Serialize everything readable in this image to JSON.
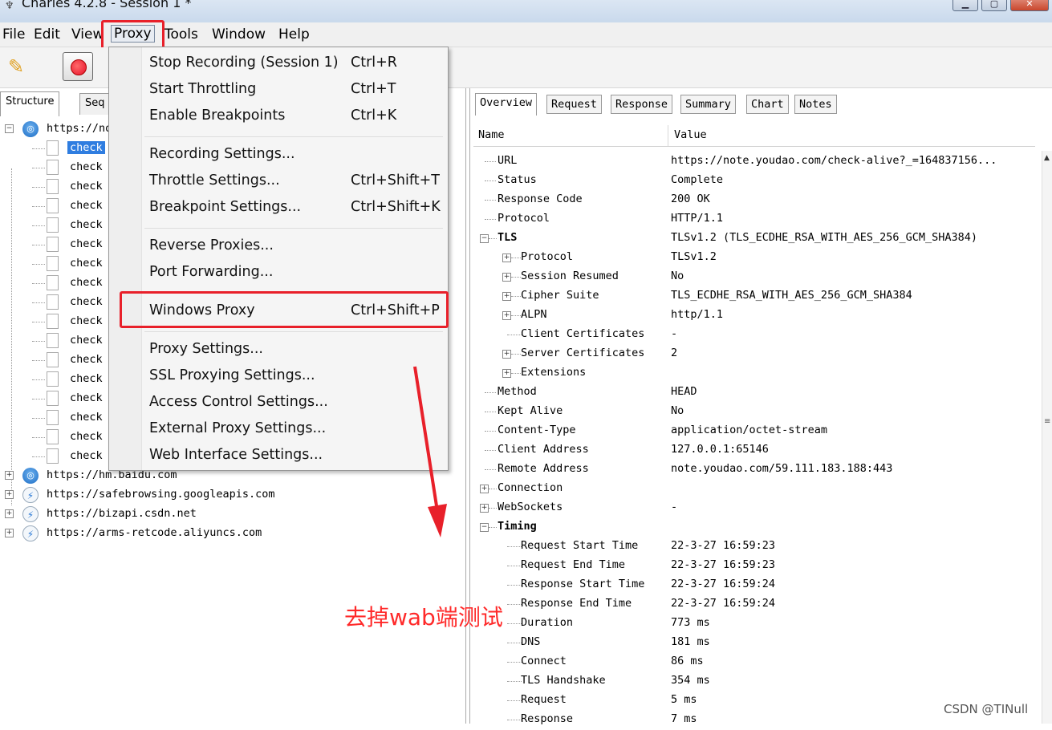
{
  "window": {
    "title": "Charles 4.2.8 - Session 1 *",
    "buttons": [
      "▁",
      "▢",
      "✕"
    ]
  },
  "menubar": [
    "File",
    "Edit",
    "View",
    "Proxy",
    "Tools",
    "Window",
    "Help"
  ],
  "left_tabs": [
    "Structure",
    "Seq"
  ],
  "tree": {
    "hosts_top": [
      {
        "label": "https://note.youdao.com"
      }
    ],
    "requests": [
      "check",
      "check",
      "check",
      "check",
      "check",
      "check",
      "check",
      "check",
      "check",
      "check",
      "check",
      "check",
      "check",
      "check",
      "check",
      "check",
      "check"
    ],
    "hosts_bottom": [
      {
        "label": "https://hm.baidu.com",
        "icon": "globe-icon"
      },
      {
        "label": "https://safebrowsing.googleapis.com",
        "icon": "bolt-icon"
      },
      {
        "label": "https://bizapi.csdn.net",
        "icon": "bolt-icon"
      },
      {
        "label": "https://arms-retcode.aliyuncs.com",
        "icon": "bolt-icon"
      }
    ]
  },
  "proxy_menu": {
    "items": [
      {
        "label": "Stop Recording (Session 1)",
        "shortcut": "Ctrl+R"
      },
      {
        "label": "Start Throttling",
        "shortcut": "Ctrl+T"
      },
      {
        "label": "Enable Breakpoints",
        "shortcut": "Ctrl+K"
      },
      {
        "label": "Recording Settings...",
        "shortcut": ""
      },
      {
        "label": "Throttle Settings...",
        "shortcut": "Ctrl+Shift+T"
      },
      {
        "label": "Breakpoint Settings...",
        "shortcut": "Ctrl+Shift+K"
      },
      {
        "label": "Reverse Proxies...",
        "shortcut": ""
      },
      {
        "label": "Port Forwarding...",
        "shortcut": ""
      },
      {
        "label": "Windows Proxy",
        "shortcut": "Ctrl+Shift+P"
      },
      {
        "label": "Proxy Settings...",
        "shortcut": ""
      },
      {
        "label": "SSL Proxying Settings...",
        "shortcut": ""
      },
      {
        "label": "Access Control Settings...",
        "shortcut": ""
      },
      {
        "label": "External Proxy Settings...",
        "shortcut": ""
      },
      {
        "label": "Web Interface Settings...",
        "shortcut": ""
      }
    ]
  },
  "right_tabs": [
    "Overview",
    "Request",
    "Response",
    "Summary",
    "Chart",
    "Notes"
  ],
  "overview": {
    "col_name": "Name",
    "col_value": "Value",
    "rows": [
      {
        "name": "URL",
        "value": "https://note.youdao.com/check-alive?_=164837156..."
      },
      {
        "name": "Status",
        "value": "Complete"
      },
      {
        "name": "Response Code",
        "value": "200 OK"
      },
      {
        "name": "Protocol",
        "value": "HTTP/1.1"
      },
      {
        "name": "TLS",
        "value": "TLSv1.2 (TLS_ECDHE_RSA_WITH_AES_256_GCM_SHA384)"
      },
      {
        "name": "Protocol",
        "value": "TLSv1.2"
      },
      {
        "name": "Session Resumed",
        "value": "No"
      },
      {
        "name": "Cipher Suite",
        "value": "TLS_ECDHE_RSA_WITH_AES_256_GCM_SHA384"
      },
      {
        "name": "ALPN",
        "value": "http/1.1"
      },
      {
        "name": "Client Certificates",
        "value": "-"
      },
      {
        "name": "Server Certificates",
        "value": "2"
      },
      {
        "name": "Extensions",
        "value": ""
      },
      {
        "name": "Method",
        "value": "HEAD"
      },
      {
        "name": "Kept Alive",
        "value": "No"
      },
      {
        "name": "Content-Type",
        "value": "application/octet-stream"
      },
      {
        "name": "Client Address",
        "value": "127.0.0.1:65146"
      },
      {
        "name": "Remote Address",
        "value": "note.youdao.com/59.111.183.188:443"
      },
      {
        "name": "Connection",
        "value": ""
      },
      {
        "name": "WebSockets",
        "value": "-"
      },
      {
        "name": "Timing",
        "value": ""
      },
      {
        "name": "Request Start Time",
        "value": "22-3-27 16:59:23"
      },
      {
        "name": "Request End Time",
        "value": "22-3-27 16:59:23"
      },
      {
        "name": "Response Start Time",
        "value": "22-3-27 16:59:24"
      },
      {
        "name": "Response End Time",
        "value": "22-3-27 16:59:24"
      },
      {
        "name": "Duration",
        "value": "773 ms"
      },
      {
        "name": "DNS",
        "value": "181 ms"
      },
      {
        "name": "Connect",
        "value": "86 ms"
      },
      {
        "name": "TLS Handshake",
        "value": "354 ms"
      },
      {
        "name": "Request",
        "value": "5 ms"
      },
      {
        "name": "Response",
        "value": "7 ms"
      }
    ]
  },
  "annotation": "去掉wab端测试",
  "watermark": "CSDN @TINull",
  "colors": {
    "annotation": "#e8202a",
    "selection": "#2f7de0"
  }
}
